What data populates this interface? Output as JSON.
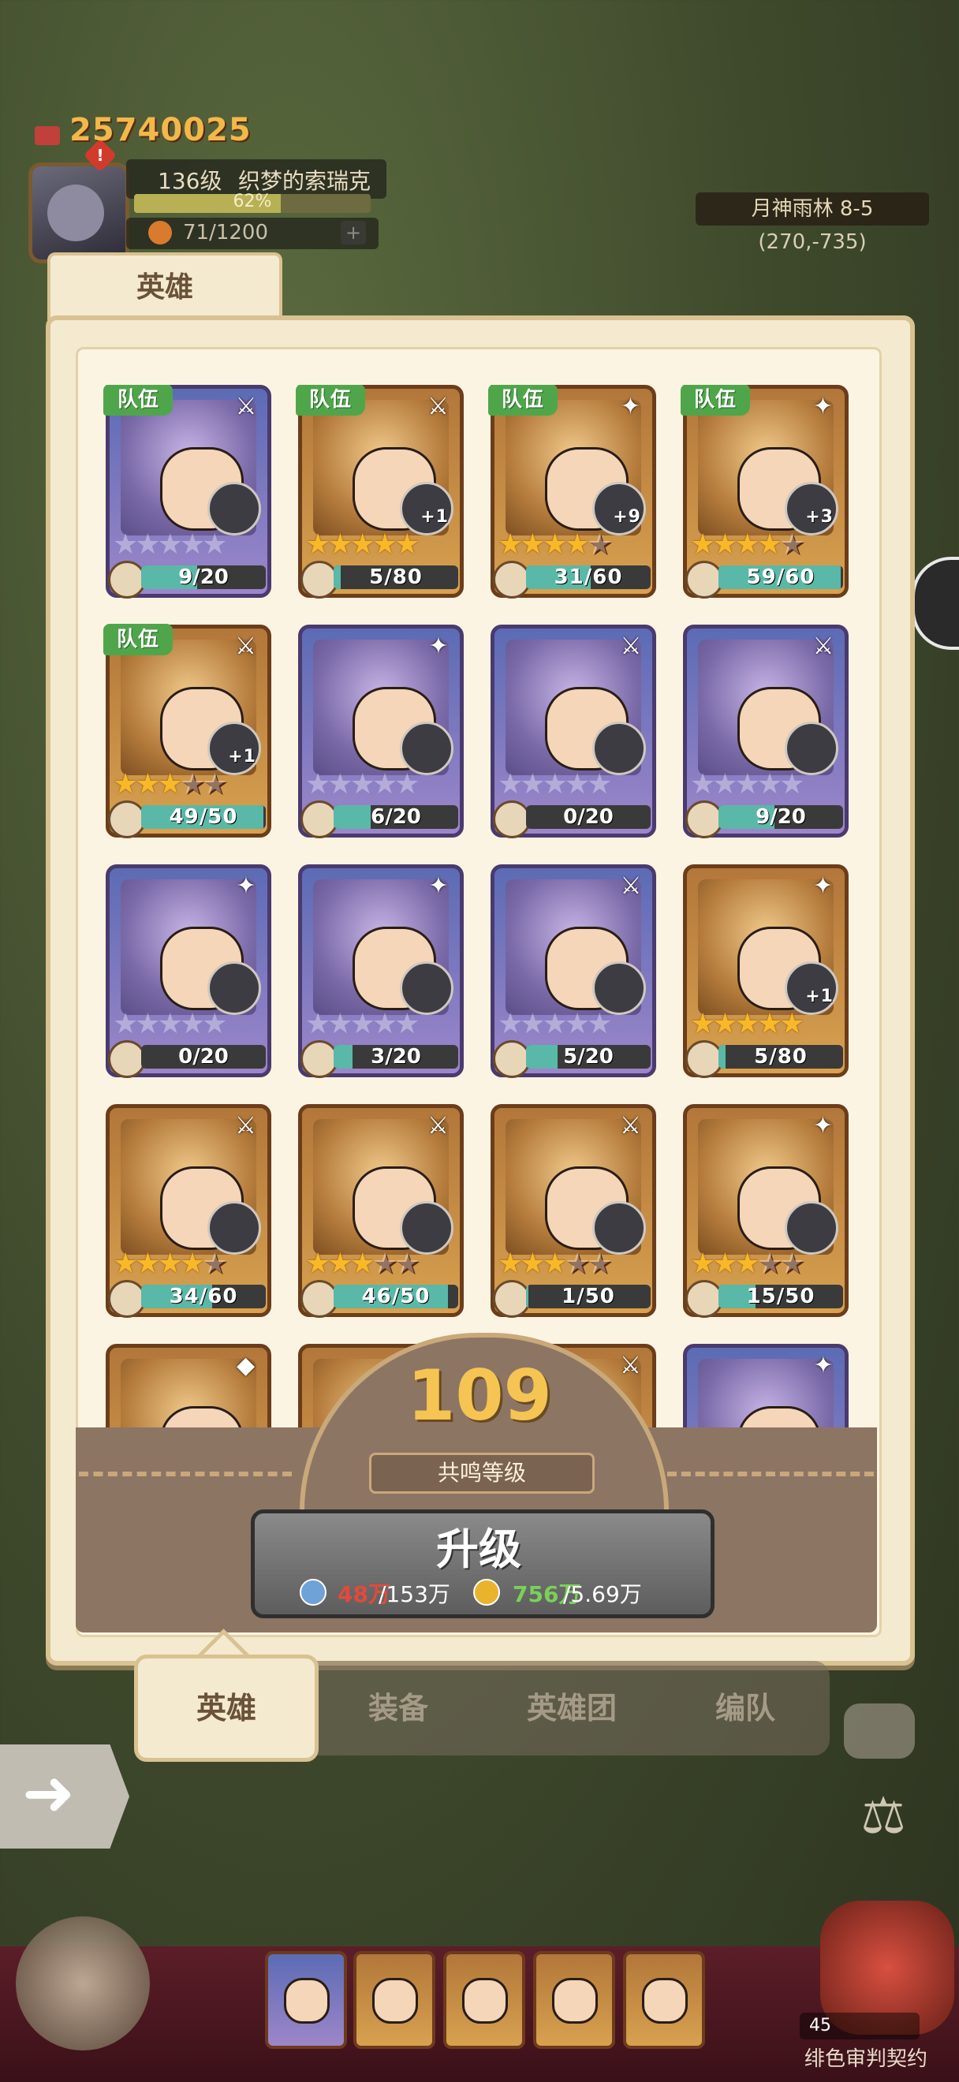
{
  "hud": {
    "gold": "25740025",
    "player_level": "136级",
    "player_name": "织梦的索瑞克",
    "exp_percent": "62%",
    "exp_fraction": 0.62,
    "stamina": "71/1200",
    "stamina_plus": "+",
    "alert": "!",
    "map_name": "月神雨林 8-5",
    "map_coord": "(270,-735)"
  },
  "panel": {
    "title": "英雄",
    "team_badge": "队伍"
  },
  "heroes": [
    {
      "team": true,
      "frame": "purple",
      "stars": 0,
      "plus": "",
      "progress": "9/20",
      "ratio": 0.45,
      "class_icon": "⚔"
    },
    {
      "team": true,
      "frame": "gold",
      "stars": 5,
      "plus": "+1",
      "progress": "5/80",
      "ratio": 0.06,
      "class_icon": "⚔"
    },
    {
      "team": true,
      "frame": "gold",
      "stars": 4,
      "plus": "+9",
      "progress": "31/60",
      "ratio": 0.52,
      "class_icon": "✦"
    },
    {
      "team": true,
      "frame": "gold",
      "stars": 4,
      "plus": "+3",
      "progress": "59/60",
      "ratio": 0.98,
      "class_icon": "✦"
    },
    {
      "team": true,
      "frame": "gold",
      "stars": 3,
      "plus": "+1",
      "progress": "49/50",
      "ratio": 0.98,
      "class_icon": "⚔"
    },
    {
      "team": false,
      "frame": "purple",
      "stars": 0,
      "plus": "",
      "progress": "6/20",
      "ratio": 0.3,
      "class_icon": "✦"
    },
    {
      "team": false,
      "frame": "purple",
      "stars": 0,
      "plus": "",
      "progress": "0/20",
      "ratio": 0.0,
      "class_icon": "⚔"
    },
    {
      "team": false,
      "frame": "purple",
      "stars": 0,
      "plus": "",
      "progress": "9/20",
      "ratio": 0.45,
      "class_icon": "⚔"
    },
    {
      "team": false,
      "frame": "purple",
      "stars": 0,
      "plus": "",
      "progress": "0/20",
      "ratio": 0.0,
      "class_icon": "✦"
    },
    {
      "team": false,
      "frame": "purple",
      "stars": 0,
      "plus": "",
      "progress": "3/20",
      "ratio": 0.15,
      "class_icon": "✦"
    },
    {
      "team": false,
      "frame": "purple",
      "stars": 0,
      "plus": "",
      "progress": "5/20",
      "ratio": 0.25,
      "class_icon": "⚔"
    },
    {
      "team": false,
      "frame": "gold",
      "stars": 5,
      "plus": "+1",
      "progress": "5/80",
      "ratio": 0.06,
      "class_icon": "✦"
    },
    {
      "team": false,
      "frame": "gold",
      "stars": 4,
      "plus": "",
      "progress": "34/60",
      "ratio": 0.57,
      "class_icon": "⚔"
    },
    {
      "team": false,
      "frame": "gold",
      "stars": 3,
      "plus": "",
      "progress": "46/50",
      "ratio": 0.92,
      "class_icon": "⚔"
    },
    {
      "team": false,
      "frame": "gold",
      "stars": 3,
      "plus": "",
      "progress": "1/50",
      "ratio": 0.02,
      "class_icon": "⚔"
    },
    {
      "team": false,
      "frame": "gold",
      "stars": 3,
      "plus": "",
      "progress": "15/50",
      "ratio": 0.3,
      "class_icon": "✦"
    },
    {
      "team": false,
      "frame": "gold",
      "stars": 0,
      "plus": "",
      "progress": "",
      "ratio": 0.0,
      "class_icon": "◆"
    },
    {
      "team": false,
      "frame": "gold",
      "stars": 0,
      "plus": "",
      "progress": "",
      "ratio": 0.0,
      "class_icon": "⚔"
    },
    {
      "team": false,
      "frame": "gold",
      "stars": 0,
      "plus": "",
      "progress": "",
      "ratio": 0.0,
      "class_icon": "⚔"
    },
    {
      "team": false,
      "frame": "purple",
      "stars": 0,
      "plus": "",
      "progress": "",
      "ratio": 0.0,
      "class_icon": "✦"
    }
  ],
  "resonance": {
    "level": "109",
    "label": "共鸣等级",
    "button": "升级",
    "cost1_have": "48万",
    "cost1_need": "/153万",
    "cost2_have": "756万",
    "cost2_need": "/5.69万"
  },
  "tabs": [
    "英雄",
    "装备",
    "英雄团",
    "编队"
  ],
  "bottom": {
    "count": "45",
    "contract": "绯色审判契约"
  },
  "colors": {
    "gold_text": "#f2b84a",
    "team_green": "#4fa64a",
    "star": "#f7b928",
    "insufficient": "#e24a3a",
    "sufficient": "#7ad05a"
  }
}
